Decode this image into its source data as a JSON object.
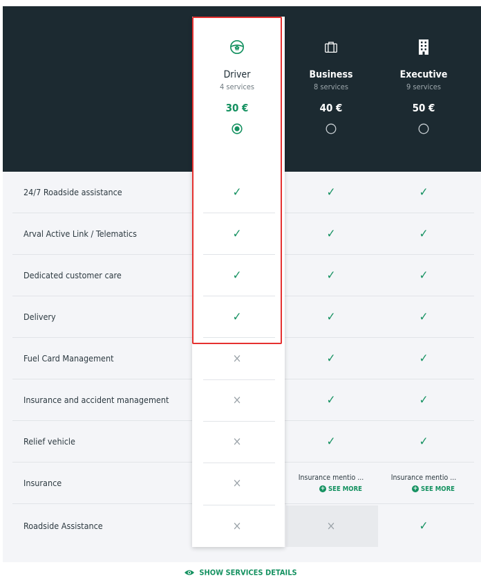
{
  "plans": [
    {
      "name": "Driver",
      "services": "4 services",
      "price": "30 €",
      "icon": "steering-wheel-icon",
      "selected": true
    },
    {
      "name": "Business",
      "services": "8 services",
      "price": "40 €",
      "icon": "briefcase-icon",
      "selected": false
    },
    {
      "name": "Executive",
      "services": "9 services",
      "price": "50 €",
      "icon": "building-icon",
      "selected": false
    }
  ],
  "rows": [
    {
      "label": "24/7 Roadside assistance",
      "driver": "✓",
      "business": "✓",
      "executive": "✓"
    },
    {
      "label": "Arval Active Link / Telematics",
      "driver": "✓",
      "business": "✓",
      "executive": "✓"
    },
    {
      "label": "Dedicated customer care",
      "driver": "✓",
      "business": "✓",
      "executive": "✓"
    },
    {
      "label": "Delivery",
      "driver": "✓",
      "business": "✓",
      "executive": "✓"
    },
    {
      "label": "Fuel Card Management",
      "driver": "×",
      "business": "✓",
      "executive": "✓"
    },
    {
      "label": "Insurance and accident management",
      "driver": "×",
      "business": "✓",
      "executive": "✓"
    },
    {
      "label": "Relief vehicle",
      "driver": "×",
      "business": "✓",
      "executive": "✓"
    },
    {
      "label": "Insurance",
      "driver": "×",
      "business": "Insurance mentio ...",
      "executive": "Insurance mentio ..."
    },
    {
      "label": "Roadside Assistance",
      "driver": "×",
      "business": "×",
      "executive": "✓"
    }
  ],
  "see_more_label": "SEE MORE",
  "footer_label": "SHOW SERVICES DETAILS",
  "colors": {
    "header_bg": "#1c2a31",
    "accent": "#149160",
    "highlight_frame": "#e5302f"
  }
}
